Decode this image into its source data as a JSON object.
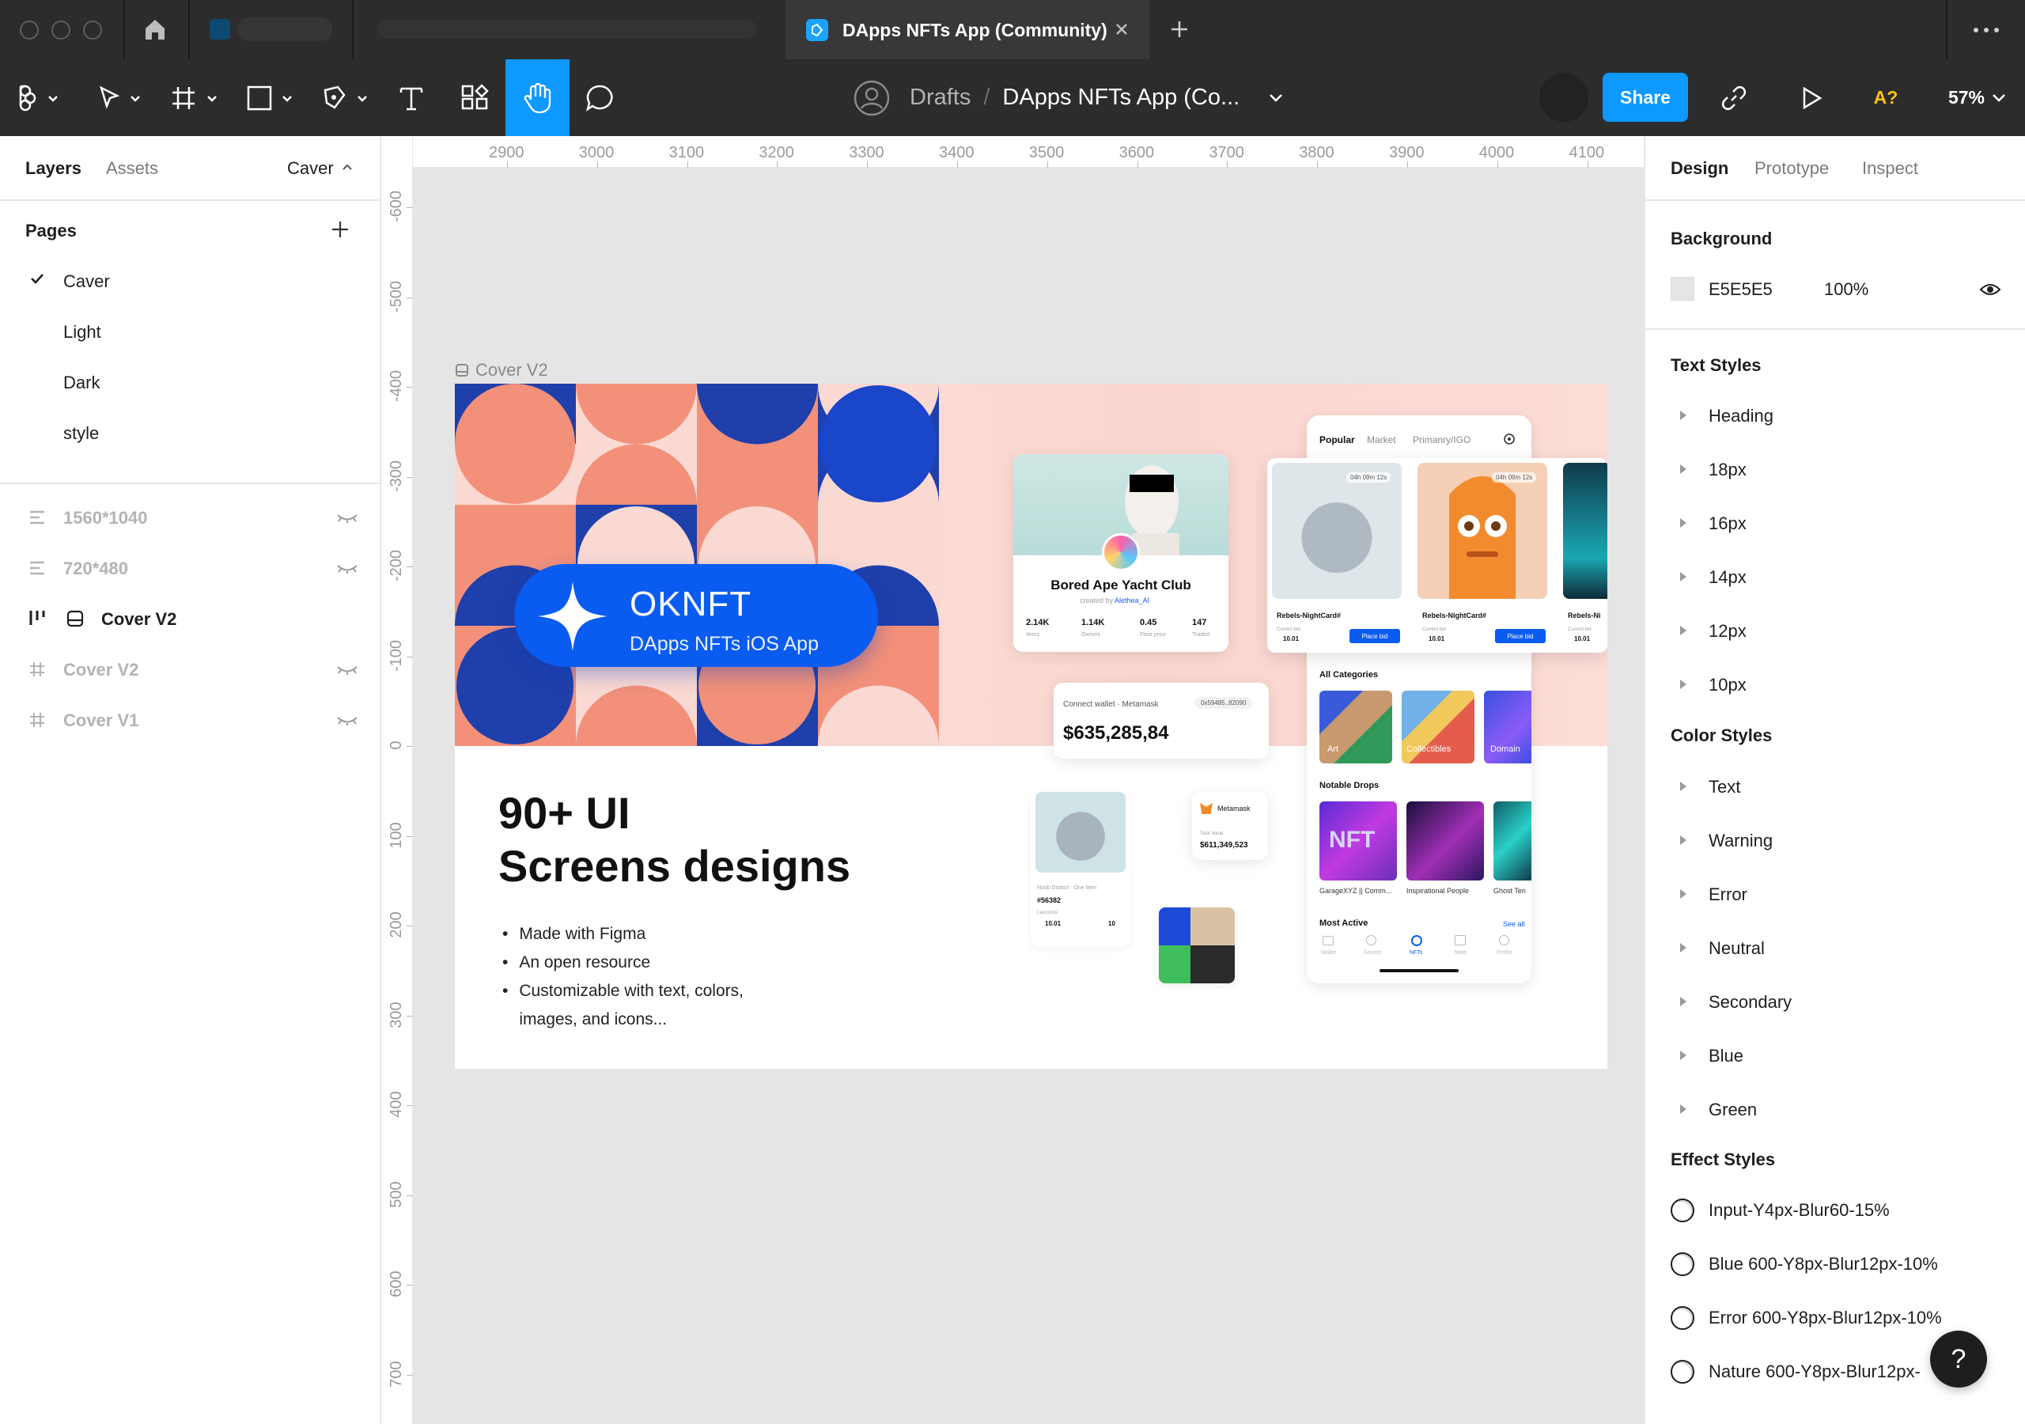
{
  "tabs": {
    "active_title": "DApps NFTs App (Community)"
  },
  "toolbar": {
    "breadcrumb_root": "Drafts",
    "breadcrumb_sep": "/",
    "file_title": "DApps NFTs App (Co...",
    "share_label": "Share",
    "font_warning": "A?",
    "zoom": "57%"
  },
  "left_panel": {
    "tabs": [
      "Layers",
      "Assets"
    ],
    "current_page_menu": "Caver",
    "pages_title": "Pages",
    "pages": [
      "Caver",
      "Light",
      "Dark",
      "style"
    ],
    "layers": [
      {
        "name": "1560*1040",
        "kind": "section"
      },
      {
        "name": "720*480",
        "kind": "section"
      },
      {
        "name": "Cover V2",
        "kind": "component"
      },
      {
        "name": "Cover V2",
        "kind": "frame"
      },
      {
        "name": "Cover V1",
        "kind": "frame"
      }
    ]
  },
  "rulers": {
    "horizontal": [
      "2900",
      "3000",
      "3100",
      "3200",
      "3300",
      "3400",
      "3500",
      "3600",
      "3700",
      "3800",
      "3900",
      "4000",
      "4100"
    ],
    "vertical": [
      "-600",
      "-500",
      "-400",
      "-300",
      "-200",
      "-100",
      "0",
      "100",
      "200",
      "300",
      "400",
      "500",
      "600",
      "700"
    ]
  },
  "frame": {
    "label": "Cover V2",
    "brand": "OKNFT",
    "brand_sub": "DApps NFTs iOS App",
    "headline_1": "90+ UI",
    "headline_2": "Screens designs",
    "bullets": [
      "Made with Figma",
      "An open resource",
      "Customizable with text, colors,",
      "images, and icons..."
    ],
    "profile": {
      "name": "Bored Ape Yacht Club",
      "created_by": "created by",
      "author": "Alethea_AI",
      "stats": [
        "2.14K",
        "1.14K",
        "0.45",
        "147"
      ],
      "stat_labels": [
        "Items",
        "Owners",
        "Floor price",
        "Traded"
      ]
    },
    "wallet": {
      "label": "Connect wallet · Metamask",
      "address": "0x59485..82090",
      "balance": "$635,285,84"
    },
    "market_tabs": [
      "Popular",
      "Market",
      "Primanry/IGO"
    ],
    "timer": "04h 09m 12s",
    "nft_name": "Rebels-NightCard#",
    "nft_name_short": "Rebels-Ni",
    "bid_label": "Current bid",
    "bid_value": "10.01",
    "place_bid": "Place bid",
    "categories_title": "All Categories",
    "categories": [
      "Art",
      "Collectibles",
      "Domain"
    ],
    "notable_title": "Notable Drops",
    "notable": [
      "GarageXYZ || Comm...",
      "Inspirational People",
      "Ghost Ten"
    ],
    "most_active": "Most Active",
    "see_all": "See all",
    "nav": [
      "Wallet",
      "Search",
      "NFTs",
      "Stats",
      "Profile"
    ],
    "small_card": {
      "title": "Noob District · One Item",
      "id": "#56382",
      "last_price": "Last price",
      "price": "10.01",
      "likes": "10"
    },
    "metamask": {
      "name": "Metamask",
      "total_label": "Total Value",
      "total": "$611,349,523"
    }
  },
  "right_panel": {
    "tabs": [
      "Design",
      "Prototype",
      "Inspect"
    ],
    "background_title": "Background",
    "background_hex": "E5E5E5",
    "background_opacity": "100%",
    "text_styles_title": "Text Styles",
    "text_styles": [
      "Heading",
      "18px",
      "16px",
      "14px",
      "12px",
      "10px"
    ],
    "color_styles_title": "Color Styles",
    "color_styles": [
      "Text",
      "Warning",
      "Error",
      "Neutral",
      "Secondary",
      "Blue",
      "Green"
    ],
    "effect_styles_title": "Effect Styles",
    "effect_styles": [
      "Input-Y4px-Blur60-15%",
      "Blue 600-Y8px-Blur12px-10%",
      "Error 600-Y8px-Blur12px-10%",
      "Nature 600-Y8px-Blur12px-"
    ]
  },
  "help_label": "?",
  "colors": {
    "accent": "#0d99ff",
    "brand_blue": "#0a5cf0",
    "navy": "#1f3faa",
    "coral": "#f2907a",
    "pink": "#fbd9d3",
    "canvas": "#e5e5e5"
  }
}
